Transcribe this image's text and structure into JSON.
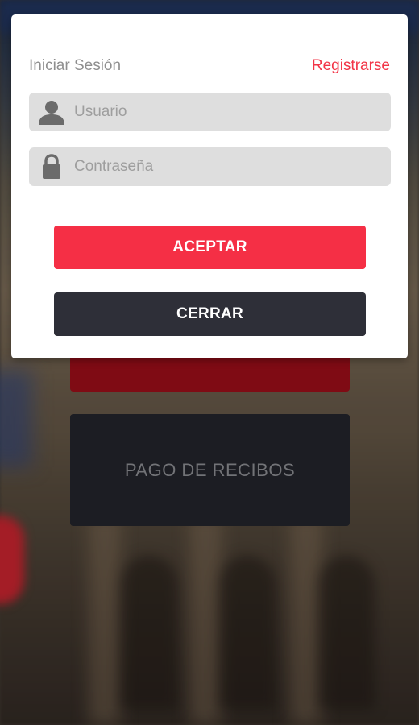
{
  "login_dialog": {
    "title": "Iniciar Sesión",
    "register_link": "Registrarse",
    "username_placeholder": "Usuario",
    "password_placeholder": "Contraseña",
    "accept_label": "ACEPTAR",
    "close_label": "CERRAR",
    "icons": {
      "username": "user-icon",
      "password": "lock-icon"
    }
  },
  "background_menu": {
    "tiles": [
      {
        "label": ""
      },
      {
        "label": "PAGO DE RECIBOS"
      }
    ]
  },
  "colors": {
    "accent_red": "#f52f45",
    "register_red": "#f23547",
    "close_button": "#2e2f38",
    "field_bg": "#dedede",
    "tile_red": "#8a0c16",
    "tile_dark": "#1f2026"
  }
}
